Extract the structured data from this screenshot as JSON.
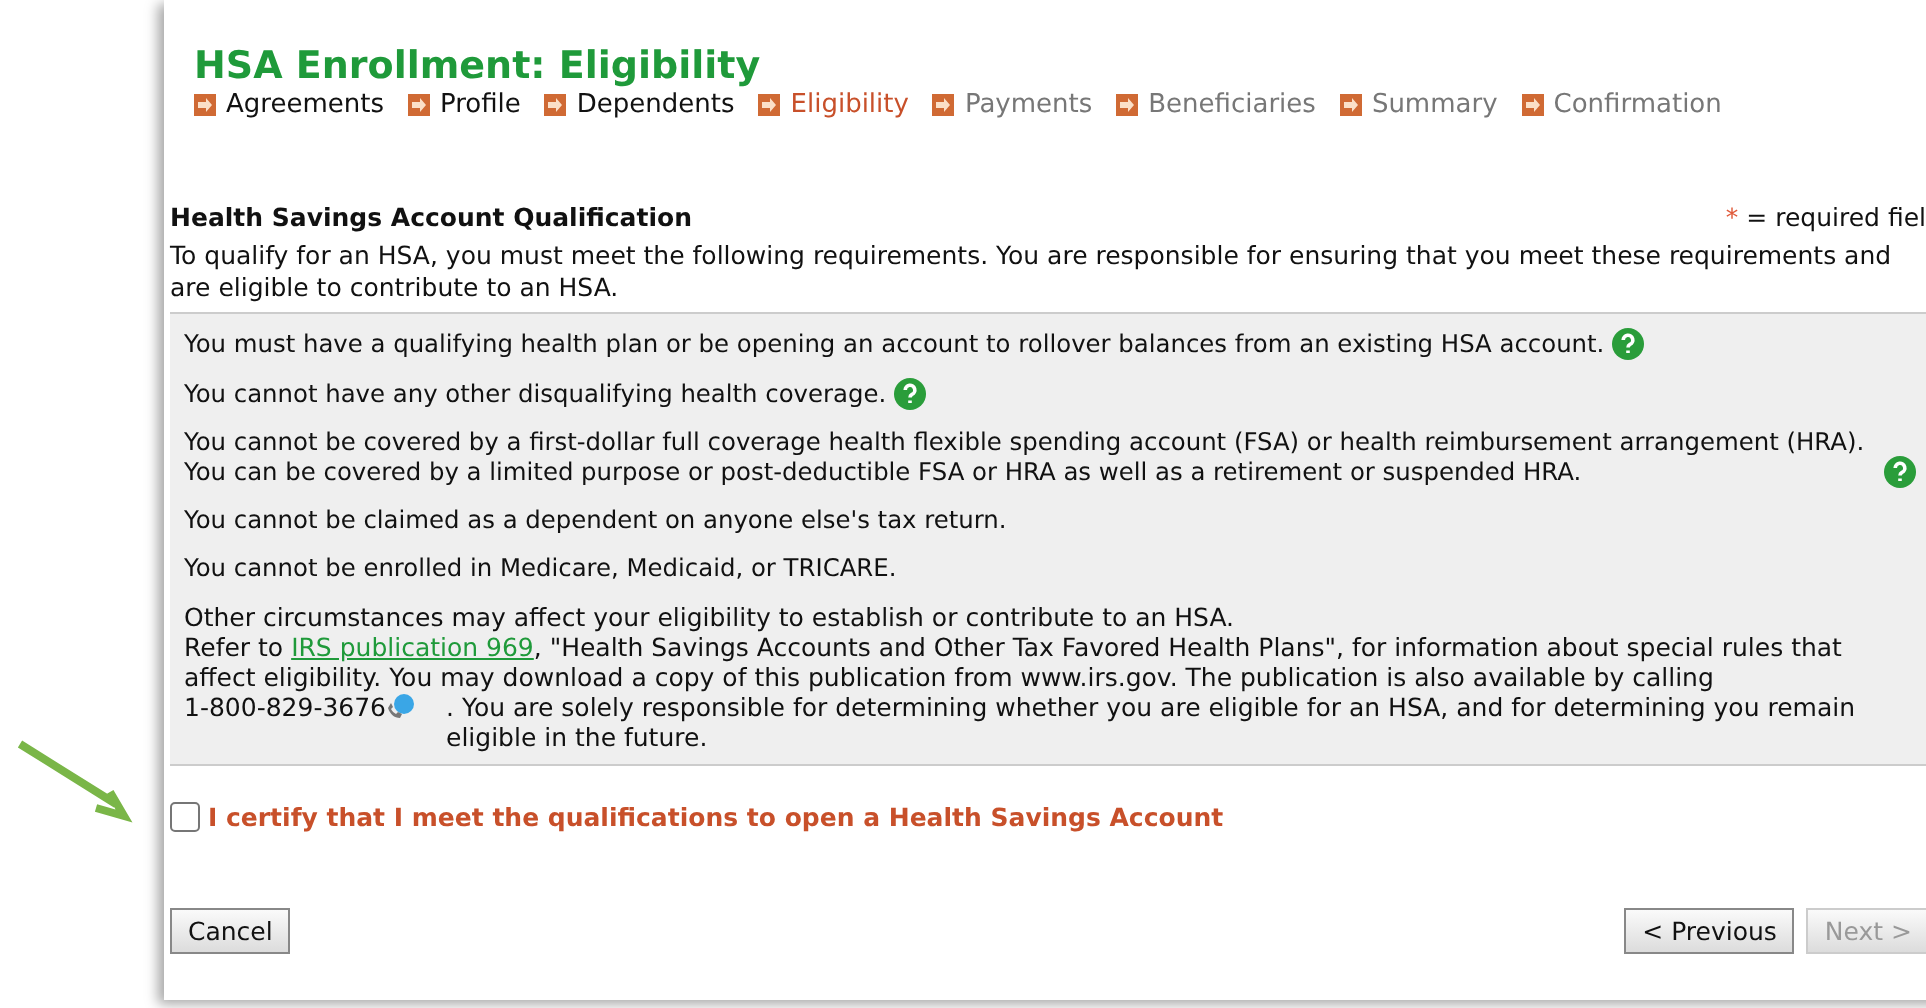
{
  "title": "HSA Enrollment: Eligibility",
  "steps": [
    {
      "label": "Agreements",
      "selected": false,
      "disabled": false
    },
    {
      "label": "Profile",
      "selected": false,
      "disabled": false
    },
    {
      "label": "Dependents",
      "selected": false,
      "disabled": false
    },
    {
      "label": "Eligibility",
      "selected": true,
      "disabled": false
    },
    {
      "label": "Payments",
      "selected": false,
      "disabled": true
    },
    {
      "label": "Beneficiaries",
      "selected": false,
      "disabled": true
    },
    {
      "label": "Summary",
      "selected": false,
      "disabled": true
    },
    {
      "label": "Confirmation",
      "selected": false,
      "disabled": true
    }
  ],
  "section": {
    "heading": "Health Savings Account Qualification",
    "required_mark": "*",
    "required_note": "= required fiel",
    "intro": "To qualify for an HSA, you must meet the following requirements. You are responsible for ensuring that you meet these requirements and are eligible to contribute to an HSA."
  },
  "requirements": [
    {
      "text": "You must have a qualifying health plan or be opening an account to rollover balances from an existing HSA account.",
      "help": true
    },
    {
      "text": "You cannot have any other disqualifying health coverage.",
      "help": true
    },
    {
      "text": "You cannot be covered by a first-dollar full coverage health flexible spending account (FSA) or health reimbursement arrangement (HRA). You can be covered by a limited purpose or post-deductible FSA or HRA as well as a retirement or suspended HRA.",
      "help": true
    },
    {
      "text": "You cannot be claimed as a dependent on anyone else's tax return.",
      "help": false
    },
    {
      "text": "You cannot be enrolled in Medicare, Medicaid, or TRICARE.",
      "help": false
    }
  ],
  "notice": {
    "line1": "Other circumstances may affect your eligibility to establish or contribute to an HSA.",
    "before_link": "Refer to",
    "link": "IRS publication 969",
    "after_link": ", \"Health Savings Accounts and Other Tax Favored Health Plans\", for information about special rules that affect eligibility. You may download a copy of this publication from www.irs.gov. The publication is also available by calling",
    "phone": "1-800-829-3676",
    "after_phone": ". You are solely responsible for determining whether you are eligible for an HSA, and for determining you remain eligible in the future."
  },
  "certify": {
    "label": "I certify that I meet the qualifications to open a Health Savings Account",
    "checked": false
  },
  "buttons": {
    "cancel": {
      "label": "Cancel",
      "disabled": false
    },
    "previous": {
      "label": "< Previous",
      "disabled": false
    },
    "next": {
      "label": "Next >",
      "disabled": true
    }
  }
}
